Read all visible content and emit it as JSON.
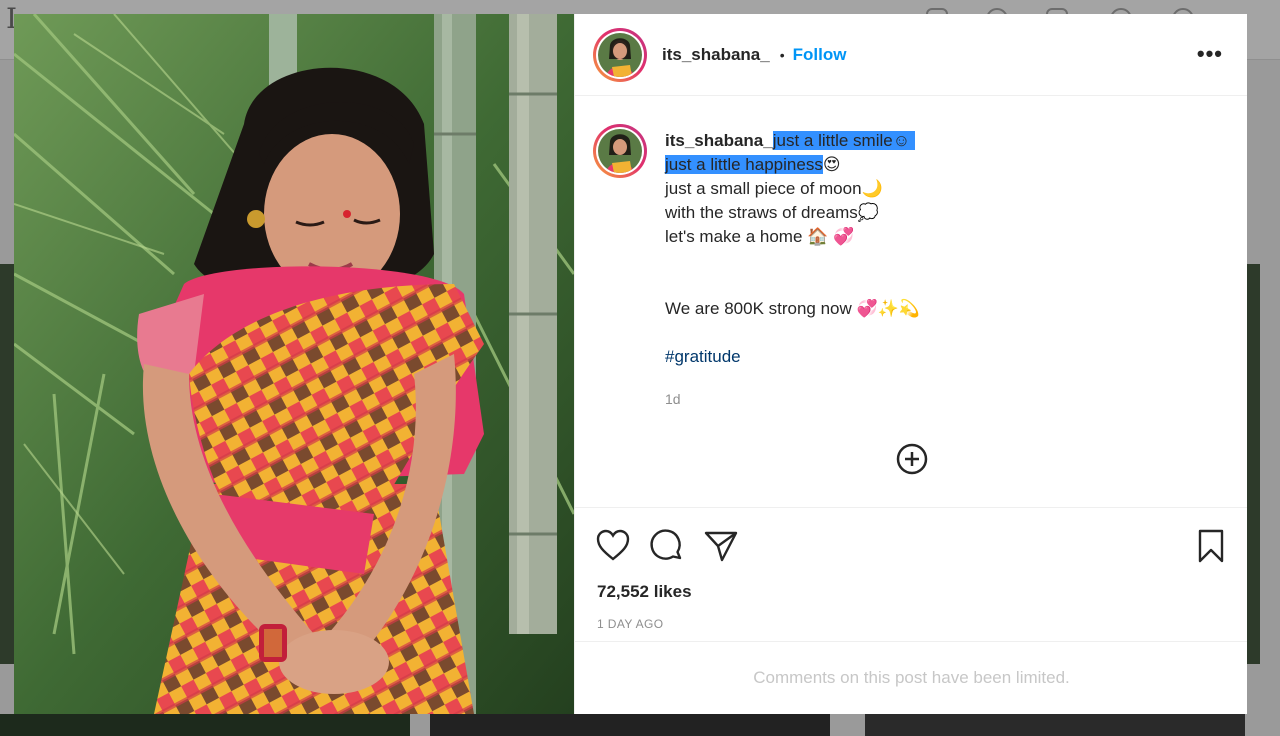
{
  "background": {
    "logo_text": "I"
  },
  "post": {
    "username": "its_shabana_",
    "separator": "•",
    "follow_label": "Follow",
    "more_label": "•••",
    "caption": {
      "username": "its_shabana_",
      "line1": "just a little smile",
      "line1_emoji": "☺",
      "line2": "just a little happiness",
      "line2_emoji": "😍",
      "line3": "just a small piece of moon",
      "line3_emoji": "🌙",
      "line4": "with the straws of dreams",
      "line4_emoji": "💭",
      "line5": "let's make a home",
      "line5_emoji": "🏠 💞",
      "line6": "We are 800K strong now",
      "line6_emoji": "💞✨💫",
      "hashtag": "#gratitude",
      "time": "1d"
    },
    "likes": "72,552 likes",
    "date": "1 DAY AGO",
    "comments_limited": "Comments on this post have been limited."
  },
  "colors": {
    "follow": "#0095f6",
    "highlight": "#3390ff",
    "hashtag": "#00376b"
  },
  "icons": [
    "heart-icon",
    "comment-icon",
    "share-icon",
    "bookmark-icon",
    "add-circle-icon",
    "more-icon"
  ]
}
